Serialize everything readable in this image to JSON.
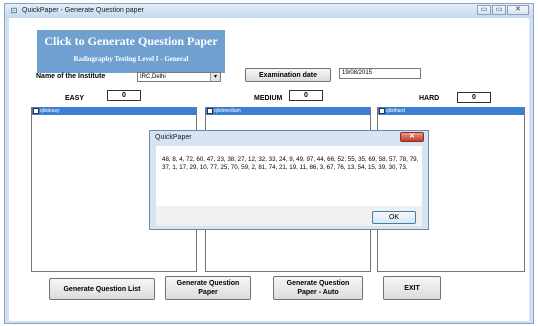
{
  "window": {
    "title": "QuickPaper - Generate Question paper",
    "controls": [
      "▭",
      "▭",
      "✕"
    ]
  },
  "banner": {
    "title": "Click to Generate Question Paper",
    "subtitle": "Radiography Testing Level I - General"
  },
  "form": {
    "institute_label": "Name of the Institute",
    "institute_value": "IRC,Delhi",
    "exam_date_button": "Examination date",
    "exam_date_value": "19/08/2015",
    "easy_label": "EASY",
    "easy_value": "0",
    "medium_label": "MEDIUM",
    "medium_value": "0",
    "hard_label": "HARD",
    "hard_value": "0"
  },
  "lists": [
    {
      "header": "qlisteasy"
    },
    {
      "header": "qlistmedium"
    },
    {
      "header": "qlisthard"
    }
  ],
  "buttons": {
    "generate_list": "Generate Question List",
    "generate_paper_line1": "Generate Question",
    "generate_paper_line2": "Paper",
    "generate_auto_line1": "Generate Question",
    "generate_auto_line2": "Paper - Auto",
    "exit": "EXIT"
  },
  "dialog": {
    "title": "QuickPaper",
    "close": "✕",
    "message": "48, 8, 4, 72, 60, 47, 23, 38, 27, 12, 32, 33, 24, 9, 49, 97, 44, 66, 52, 55, 35, 69, 58, 57, 78, 79, 37, 1, 17, 29, 10, 77, 25, 70, 59, 2, 81, 74, 21, 19, 11, 86, 3, 67, 76, 13, 54, 15, 39, 30, 73,",
    "ok": "OK"
  }
}
